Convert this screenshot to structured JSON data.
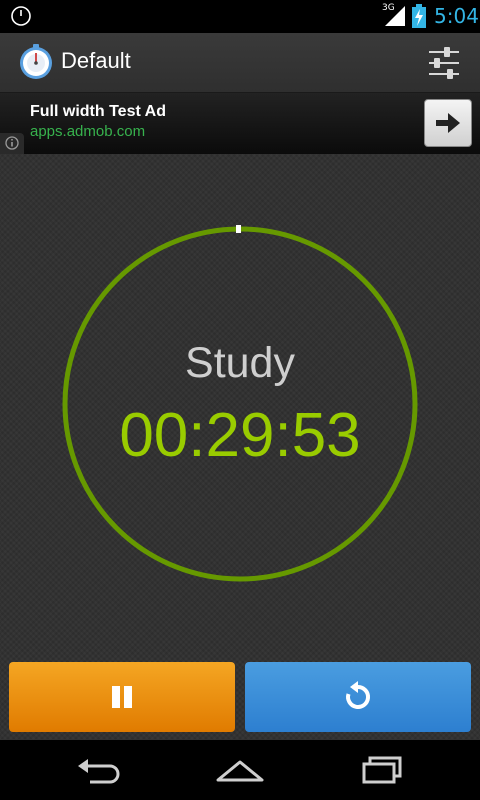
{
  "status_bar": {
    "network": "3G",
    "time": "5:04",
    "icons": [
      "alarm-icon",
      "signal-icon",
      "battery-charging-icon"
    ]
  },
  "action_bar": {
    "title": "Default",
    "icons": [
      "stopwatch-icon",
      "settings-sliders-icon"
    ]
  },
  "ad": {
    "title": "Full width Test Ad",
    "url": "apps.admob.com",
    "icons": [
      "info-icon",
      "arrow-right-icon"
    ]
  },
  "timer": {
    "label": "Study",
    "time": "00:29:53",
    "accent_color": "#99cc00"
  },
  "controls": {
    "icons": [
      "pause-icon",
      "reset-icon"
    ],
    "pause_color": "#f0a020",
    "reset_color": "#3d8fd9"
  },
  "nav_bar": {
    "icons": [
      "back-icon",
      "home-icon",
      "recent-apps-icon"
    ]
  }
}
